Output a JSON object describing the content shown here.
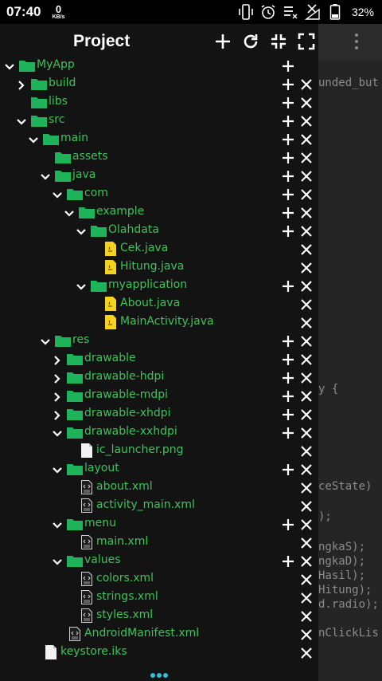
{
  "status_bar": {
    "time": "07:40",
    "net_speed_value": "0",
    "net_speed_unit": "KB/s",
    "battery": "32%",
    "icons": [
      "vibrate-icon",
      "alarm-icon",
      "notification-list-icon",
      "signal-off-icon",
      "battery-icon"
    ]
  },
  "drawer": {
    "title": "Project",
    "header_actions": [
      "add-icon",
      "refresh-icon",
      "collapse-icon",
      "expand-icon"
    ],
    "tree": [
      {
        "label": "MyApp",
        "depth": 0,
        "type": "folder",
        "expanded": true,
        "add": true,
        "del": false
      },
      {
        "label": "build",
        "depth": 1,
        "type": "folder",
        "expanded": false,
        "add": true,
        "del": true
      },
      {
        "label": "libs",
        "depth": 1,
        "type": "folder",
        "expanded": null,
        "add": true,
        "del": true
      },
      {
        "label": "src",
        "depth": 1,
        "type": "folder",
        "expanded": true,
        "add": true,
        "del": true
      },
      {
        "label": "main",
        "depth": 2,
        "type": "folder",
        "expanded": true,
        "add": true,
        "del": true
      },
      {
        "label": "assets",
        "depth": 3,
        "type": "folder",
        "expanded": null,
        "add": true,
        "del": true
      },
      {
        "label": "java",
        "depth": 3,
        "type": "folder",
        "expanded": true,
        "add": true,
        "del": true
      },
      {
        "label": "com",
        "depth": 4,
        "type": "folder",
        "expanded": true,
        "add": true,
        "del": true
      },
      {
        "label": "example",
        "depth": 5,
        "type": "folder",
        "expanded": true,
        "add": true,
        "del": true
      },
      {
        "label": "Olahdata",
        "depth": 6,
        "type": "folder",
        "expanded": true,
        "add": true,
        "del": true
      },
      {
        "label": "Cek.java",
        "depth": 7,
        "type": "java",
        "expanded": null,
        "add": false,
        "del": true
      },
      {
        "label": "Hitung.java",
        "depth": 7,
        "type": "java",
        "expanded": null,
        "add": false,
        "del": true
      },
      {
        "label": "myapplication",
        "depth": 6,
        "type": "folder",
        "expanded": true,
        "add": true,
        "del": true
      },
      {
        "label": "About.java",
        "depth": 7,
        "type": "java",
        "expanded": null,
        "add": false,
        "del": true
      },
      {
        "label": "MainActivity.java",
        "depth": 7,
        "type": "java",
        "expanded": null,
        "add": false,
        "del": true
      },
      {
        "label": "res",
        "depth": 3,
        "type": "folder",
        "expanded": true,
        "add": true,
        "del": true
      },
      {
        "label": "drawable",
        "depth": 4,
        "type": "folder",
        "expanded": false,
        "add": true,
        "del": true
      },
      {
        "label": "drawable-hdpi",
        "depth": 4,
        "type": "folder",
        "expanded": false,
        "add": true,
        "del": true
      },
      {
        "label": "drawable-mdpi",
        "depth": 4,
        "type": "folder",
        "expanded": false,
        "add": true,
        "del": true
      },
      {
        "label": "drawable-xhdpi",
        "depth": 4,
        "type": "folder",
        "expanded": false,
        "add": true,
        "del": true
      },
      {
        "label": "drawable-xxhdpi",
        "depth": 4,
        "type": "folder",
        "expanded": true,
        "add": true,
        "del": true
      },
      {
        "label": "ic_launcher.png",
        "depth": 5,
        "type": "file",
        "expanded": null,
        "add": false,
        "del": true
      },
      {
        "label": "layout",
        "depth": 4,
        "type": "folder",
        "expanded": true,
        "add": true,
        "del": true
      },
      {
        "label": "about.xml",
        "depth": 5,
        "type": "xml",
        "expanded": null,
        "add": false,
        "del": true
      },
      {
        "label": "activity_main.xml",
        "depth": 5,
        "type": "xml",
        "expanded": null,
        "add": false,
        "del": true
      },
      {
        "label": "menu",
        "depth": 4,
        "type": "folder",
        "expanded": true,
        "add": true,
        "del": true
      },
      {
        "label": "main.xml",
        "depth": 5,
        "type": "xml",
        "expanded": null,
        "add": false,
        "del": true
      },
      {
        "label": "values",
        "depth": 4,
        "type": "folder",
        "expanded": true,
        "add": true,
        "del": true
      },
      {
        "label": "colors.xml",
        "depth": 5,
        "type": "xml",
        "expanded": null,
        "add": false,
        "del": true
      },
      {
        "label": "strings.xml",
        "depth": 5,
        "type": "xml",
        "expanded": null,
        "add": false,
        "del": true
      },
      {
        "label": "styles.xml",
        "depth": 5,
        "type": "xml",
        "expanded": null,
        "add": false,
        "del": true
      },
      {
        "label": "AndroidManifest.xml",
        "depth": 4,
        "type": "xml",
        "expanded": null,
        "add": false,
        "del": true
      },
      {
        "label": "keystore.iks",
        "depth": 2,
        "type": "file",
        "expanded": null,
        "add": false,
        "del": true
      }
    ]
  },
  "editor_background": {
    "lines": [
      "unded_but",
      "y {",
      "ceState)",
      ");",
      "ngkaS);",
      "ngkaD);",
      "Hasil);",
      "Hitung);",
      "d.radio);",
      "nClickLis"
    ]
  },
  "colors": {
    "folder": "#1fb35b",
    "label": "#3fc25a",
    "java_icon": "#f4d21f",
    "drawer_bg": "#131313"
  }
}
